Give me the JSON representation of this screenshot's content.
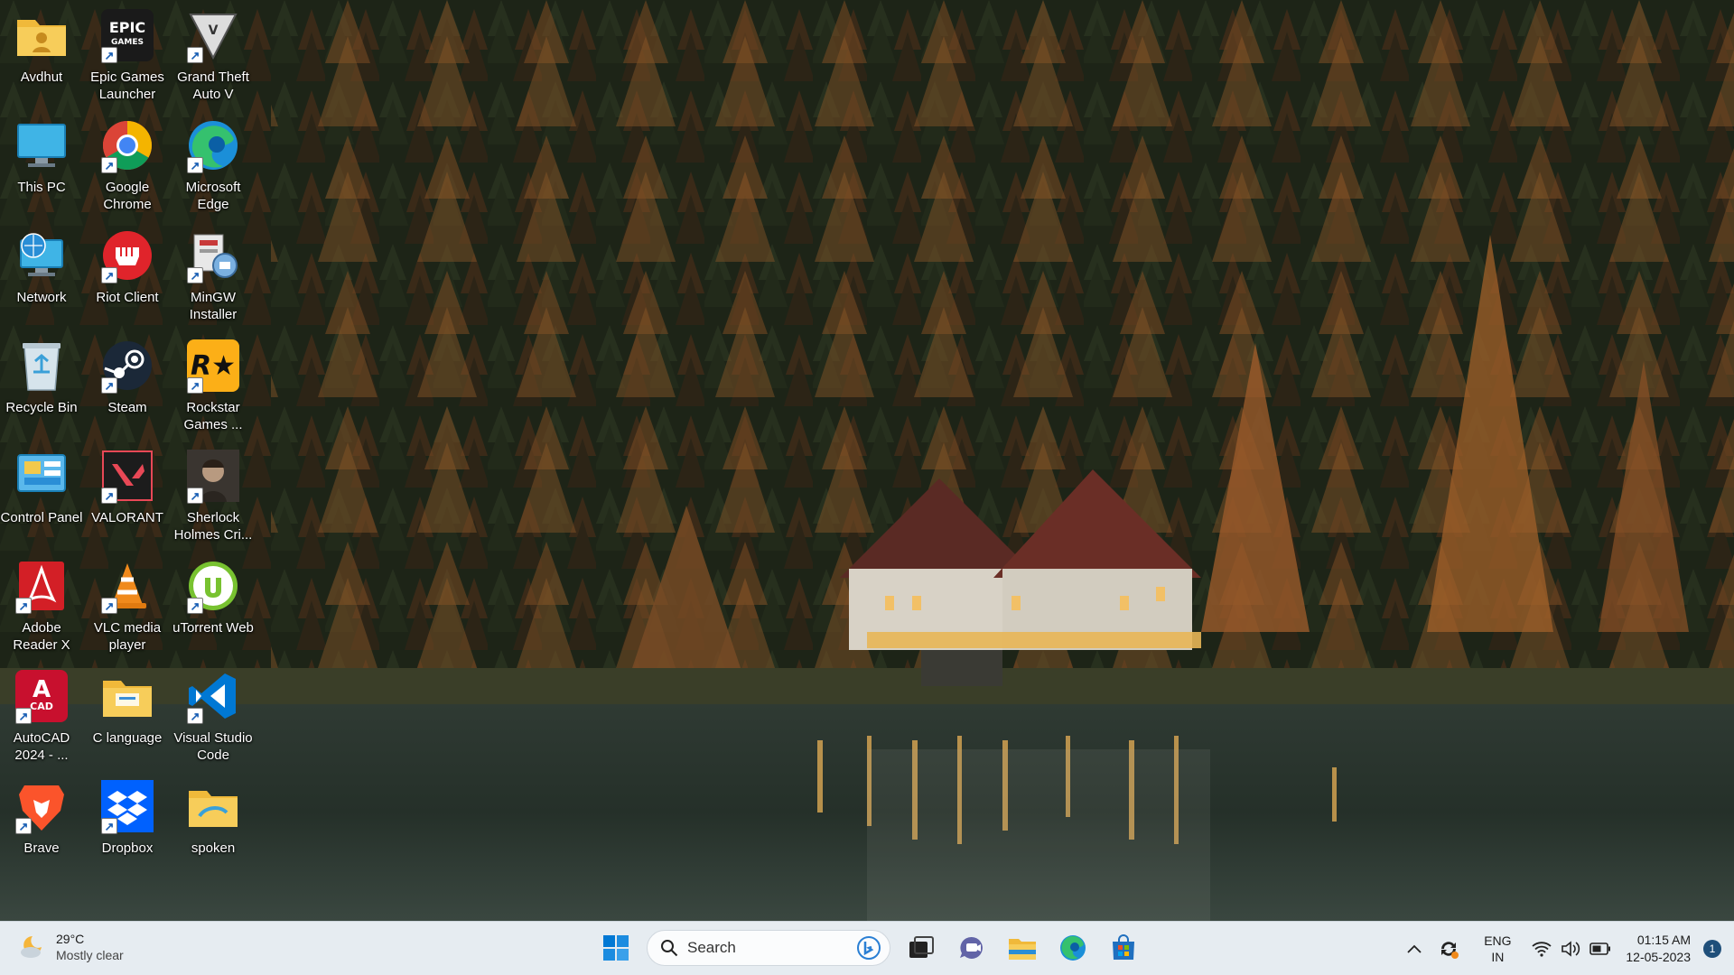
{
  "desktop": {
    "icons": [
      {
        "label": "Avdhut",
        "icon": "folder-user-icon"
      },
      {
        "label": "Epic Games Launcher",
        "icon": "epic-games-icon"
      },
      {
        "label": "Grand Theft Auto V",
        "icon": "gta-v-icon"
      },
      {
        "label": "This PC",
        "icon": "monitor-icon"
      },
      {
        "label": "Google Chrome",
        "icon": "chrome-icon"
      },
      {
        "label": "Microsoft Edge",
        "icon": "edge-icon"
      },
      {
        "label": "Network",
        "icon": "network-globe-icon"
      },
      {
        "label": "Riot Client",
        "icon": "riot-fist-icon"
      },
      {
        "label": "MinGW Installer",
        "icon": "mingw-installer-icon"
      },
      {
        "label": "Recycle Bin",
        "icon": "recycle-bin-icon"
      },
      {
        "label": "Steam",
        "icon": "steam-icon"
      },
      {
        "label": "Rockstar Games ...",
        "icon": "rockstar-icon"
      },
      {
        "label": "Control Panel",
        "icon": "control-panel-icon"
      },
      {
        "label": "VALORANT",
        "icon": "valorant-icon"
      },
      {
        "label": "Sherlock Holmes Cri...",
        "icon": "sherlock-holmes-icon"
      },
      {
        "label": "Adobe Reader X",
        "icon": "adobe-reader-icon"
      },
      {
        "label": "VLC media player",
        "icon": "vlc-cone-icon"
      },
      {
        "label": "uTorrent Web",
        "icon": "utorrent-icon"
      },
      {
        "label": "AutoCAD 2024 - ...",
        "icon": "autocad-icon"
      },
      {
        "label": "C language",
        "icon": "folder-icon"
      },
      {
        "label": "Visual Studio Code",
        "icon": "vscode-icon"
      },
      {
        "label": "Brave",
        "icon": "brave-lion-icon"
      },
      {
        "label": "Dropbox",
        "icon": "dropbox-icon"
      },
      {
        "label": "spoken",
        "icon": "folder-icon"
      }
    ]
  },
  "taskbar": {
    "weather": {
      "temp": "29°C",
      "condition": "Mostly clear",
      "icon": "moon-cloud-icon"
    },
    "search": {
      "placeholder": "Search"
    },
    "pinned": [
      "start-windows-icon",
      "task-view-icon",
      "teams-chat-icon",
      "file-explorer-icon",
      "edge-icon",
      "microsoft-store-icon"
    ],
    "tray": {
      "language_primary": "ENG",
      "language_secondary": "IN",
      "time": "01:15 AM",
      "date": "12-05-2023",
      "notifications": "1"
    }
  },
  "colors": {
    "taskbar_bg": "#e6ecf1",
    "windows_blue": "#0078d4",
    "forest_dark": "#1c2416",
    "larch_orange": "#9a5a2a"
  }
}
